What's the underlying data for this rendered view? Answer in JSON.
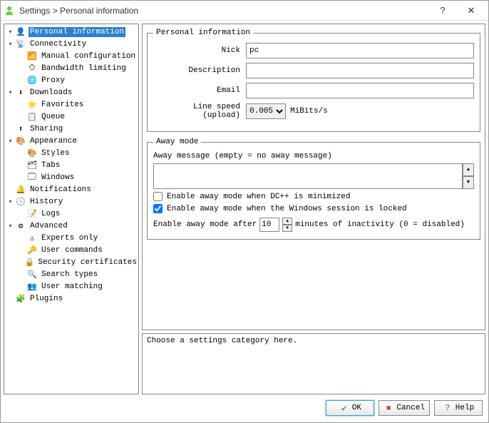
{
  "title": "Settings > Personal information",
  "sidebar": {
    "items": [
      {
        "label": "Personal information",
        "depth": 0,
        "icon": "person-icon",
        "icon_glyph": "👤",
        "expander": "▾",
        "selected": true
      },
      {
        "label": "Connectivity",
        "depth": 0,
        "icon": "antenna-icon",
        "icon_glyph": "📡",
        "expander": "▾"
      },
      {
        "label": "Manual configuration",
        "depth": 1,
        "icon": "satellite-icon",
        "icon_glyph": "📶"
      },
      {
        "label": "Bandwidth limiting",
        "depth": 1,
        "icon": "gauge-icon",
        "icon_glyph": "⏱"
      },
      {
        "label": "Proxy",
        "depth": 1,
        "icon": "globe-icon",
        "icon_glyph": "🌐"
      },
      {
        "label": "Downloads",
        "depth": 0,
        "icon": "download-icon",
        "icon_glyph": "⬇",
        "expander": "▾"
      },
      {
        "label": "Favorites",
        "depth": 1,
        "icon": "star-icon",
        "icon_glyph": "⭐"
      },
      {
        "label": "Queue",
        "depth": 1,
        "icon": "list-icon",
        "icon_glyph": "📋"
      },
      {
        "label": "Sharing",
        "depth": 0,
        "icon": "upload-icon",
        "icon_glyph": "⬆"
      },
      {
        "label": "Appearance",
        "depth": 0,
        "icon": "palette-icon",
        "icon_glyph": "🎨",
        "expander": "▾"
      },
      {
        "label": "Styles",
        "depth": 1,
        "icon": "paint-icon",
        "icon_glyph": "🎨"
      },
      {
        "label": "Tabs",
        "depth": 1,
        "icon": "tabs-icon",
        "icon_glyph": "🗂"
      },
      {
        "label": "Windows",
        "depth": 1,
        "icon": "windows-icon",
        "icon_glyph": "🗔"
      },
      {
        "label": "Notifications",
        "depth": 0,
        "icon": "bell-icon",
        "icon_glyph": "🔔"
      },
      {
        "label": "History",
        "depth": 0,
        "icon": "clock-icon",
        "icon_glyph": "🕓",
        "expander": "▾"
      },
      {
        "label": "Logs",
        "depth": 1,
        "icon": "log-icon",
        "icon_glyph": "📝"
      },
      {
        "label": "Advanced",
        "depth": 0,
        "icon": "gear-icon",
        "icon_glyph": "⚙",
        "expander": "▾"
      },
      {
        "label": "Experts only",
        "depth": 1,
        "icon": "warning-icon",
        "icon_glyph": "⚠"
      },
      {
        "label": "User commands",
        "depth": 1,
        "icon": "key-icon",
        "icon_glyph": "🔑"
      },
      {
        "label": "Security certificates",
        "depth": 1,
        "icon": "lock-icon",
        "icon_glyph": "🔒"
      },
      {
        "label": "Search types",
        "depth": 1,
        "icon": "search-icon",
        "icon_glyph": "🔍"
      },
      {
        "label": "User matching",
        "depth": 1,
        "icon": "users-icon",
        "icon_glyph": "👥"
      },
      {
        "label": "Plugins",
        "depth": 0,
        "icon": "plugin-icon",
        "icon_glyph": "🧩"
      }
    ]
  },
  "personal": {
    "legend": "Personal information",
    "nick_label": "Nick",
    "nick_value": "pc",
    "desc_label": "Description",
    "desc_value": "",
    "email_label": "Email",
    "email_value": "",
    "speed_label": "Line speed (upload)",
    "speed_value": "0.005",
    "speed_unit": "MiBits/s"
  },
  "away": {
    "legend": "Away mode",
    "msg_label": "Away message (empty = no away message)",
    "msg_value": "",
    "cb1_label": "Enable away mode when DC++ is minimized",
    "cb1_checked": false,
    "cb2_label": "Enable away mode when the Windows session is locked",
    "cb2_checked": true,
    "inactivity_prefix": "Enable away mode after",
    "inactivity_value": "10",
    "inactivity_suffix": "minutes of inactivity (0 = disabled)"
  },
  "desc_panel": "Choose a settings category here.",
  "buttons": {
    "ok": "OK",
    "cancel": "Cancel",
    "help": "Help"
  }
}
